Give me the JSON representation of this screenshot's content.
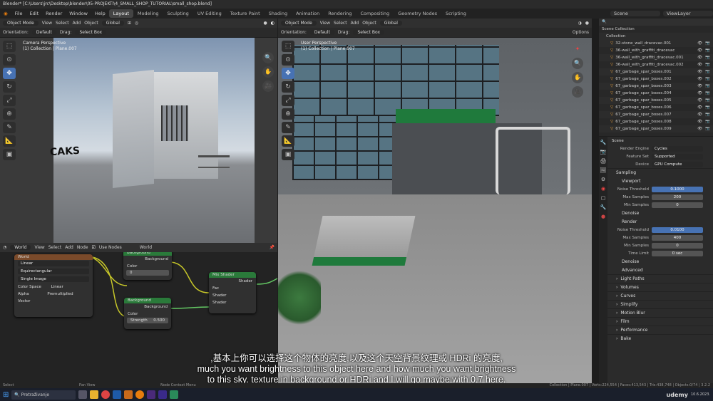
{
  "window": {
    "title": "Blender* [C:\\Users\\jrc\\Desktop\\blender\\05-PROJEKTI\\4_SMALL_SHOP_TUTORIAL\\small_shop.blend]"
  },
  "menu": [
    "File",
    "Edit",
    "Render",
    "Window",
    "Help"
  ],
  "workspaces": [
    "Layout",
    "Modeling",
    "Sculpting",
    "UV Editing",
    "Texture Paint",
    "Shading",
    "Animation",
    "Rendering",
    "Compositing",
    "Geometry Nodes",
    "Scripting"
  ],
  "active_workspace": "Layout",
  "scene_name": "Scene",
  "view_layer": "ViewLayer",
  "left_viewport": {
    "mode": "Object Mode",
    "menu": [
      "View",
      "Select",
      "Add",
      "Object"
    ],
    "transform": "Global",
    "orientation_label": "Orientation:",
    "orientation_value": "Default",
    "drag_label": "Drag:",
    "drag_value": "Select Box",
    "overlay_title": "Camera Perspective",
    "overlay_sub": "(1) Collection | Plane.007",
    "graffiti": "CAKS"
  },
  "right_viewport": {
    "mode": "Object Mode",
    "menu": [
      "View",
      "Select",
      "Add",
      "Object"
    ],
    "transform": "Global",
    "orientation_label": "Orientation:",
    "orientation_value": "Default",
    "drag_label": "Drag:",
    "drag_value": "Select Box",
    "options_label": "Options",
    "overlay_title": "User Perspective",
    "overlay_sub": "(1) Collection | Plane.007"
  },
  "node_editor": {
    "type": "World",
    "menu": [
      "View",
      "Select",
      "Add",
      "Node"
    ],
    "use_nodes": "Use Nodes",
    "world_name": "World",
    "image_node": {
      "header": "World",
      "interpolation": "Linear",
      "projection": "Equirectangular",
      "source": "Single Image",
      "color_space_label": "Color Space",
      "color_space": "Linear",
      "alpha_label": "Alpha",
      "alpha": "Premultiplied",
      "vector": "Vector"
    },
    "background1": {
      "header": "Background",
      "out": "Background",
      "color": "Color",
      "strength_value": "0"
    },
    "background2": {
      "header": "Background",
      "out": "Background",
      "color": "Color",
      "strength_label": "Strength",
      "strength_value": "0.500"
    },
    "mix": {
      "header": "Mix Shader",
      "out": "Shader",
      "fac": "Fac",
      "in1": "Shader",
      "in2": "Shader"
    }
  },
  "outliner": {
    "title": "Scene Collection",
    "collection": "Collection",
    "items": [
      "32-stone_wall_dracevac.001",
      "36-wall_with_graffiti_dracevac",
      "36-wall_with_graffiti_dracevac.001",
      "36-wall_with_graffiti_dracevac.002",
      "67_garbage_spar_boxes.001",
      "67_garbage_spar_boxes.002",
      "67_garbage_spar_boxes.003",
      "67_garbage_spar_boxes.004",
      "67_garbage_spar_boxes.005",
      "67_garbage_spar_boxes.006",
      "67_garbage_spar_boxes.007",
      "67_garbage_spar_boxes.008",
      "67_garbage_spar_boxes.009"
    ]
  },
  "properties": {
    "scene": "Scene",
    "render_engine_label": "Render Engine",
    "render_engine": "Cycles",
    "feature_set_label": "Feature Set",
    "feature_set": "Supported",
    "device_label": "Device",
    "device": "GPU Compute",
    "sampling": "Sampling",
    "viewport": "Viewport",
    "vp_noise_label": "Noise Threshold",
    "vp_noise": "0.1000",
    "vp_max_label": "Max Samples",
    "vp_max": "200",
    "vp_min_label": "Min Samples",
    "vp_min": "0",
    "denoise1": "Denoise",
    "render": "Render",
    "r_noise_label": "Noise Threshold",
    "r_noise": "0.0100",
    "r_max_label": "Max Samples",
    "r_max": "400",
    "r_min_label": "Min Samples",
    "r_min": "0",
    "time_limit_label": "Time Limit",
    "time_limit": "0 sec",
    "denoise2": "Denoise",
    "advanced": "Advanced",
    "sections": [
      "Light Paths",
      "Volumes",
      "Curves",
      "Simplify",
      "Motion Blur",
      "Film",
      "Performance",
      "Bake"
    ]
  },
  "subtitles": [
    ",基本上你可以选择这个物体的亮度,以及这个天空背景纹理或 HDRi 的亮度,",
    "much you want brightness to this object here and how much you want brightness",
    "to this sky. texture in background or HDRi and I will go maybe with 0.7 here."
  ],
  "status": {
    "left1": "Select",
    "left2": "Pan View",
    "left3": "Node Context Menu",
    "right": "Collection | Plane.007 | Verts:224,554 | Faces:413,543 | Tris:438,748 | Objects:0/74 | 3.2.2"
  },
  "taskbar": {
    "search": "Pretraživanje",
    "watermark": "udemy",
    "date": "10.6.2023."
  }
}
